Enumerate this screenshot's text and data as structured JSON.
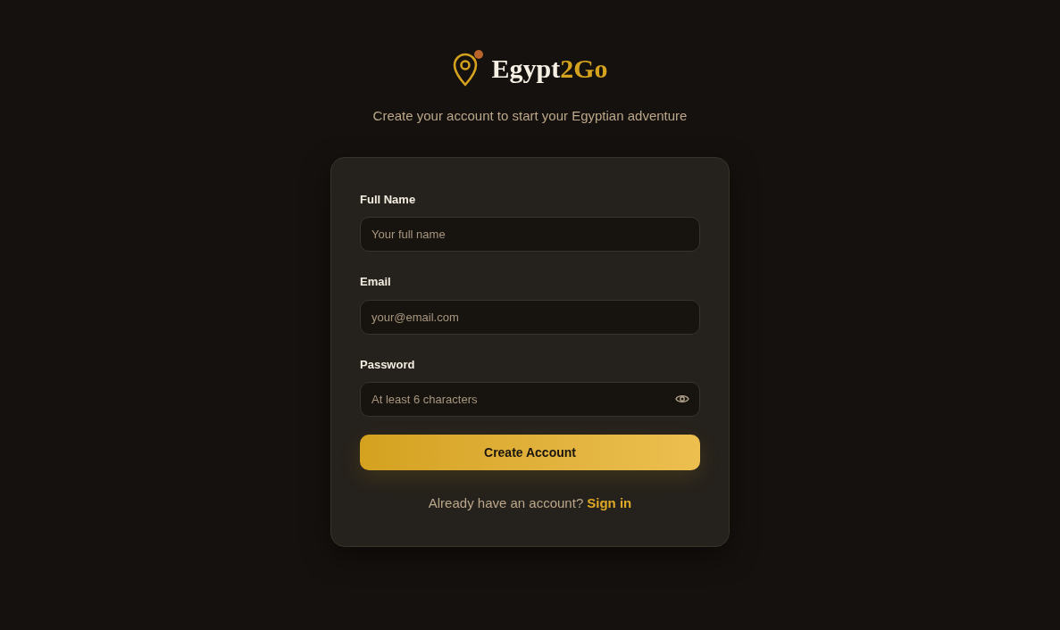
{
  "logo": {
    "parts": [
      {
        "text": "Egypt",
        "kind": "plain"
      },
      {
        "text": "2Go",
        "kind": "accent"
      }
    ]
  },
  "subtitle": "Create your account to start your Egyptian adventure",
  "fields": [
    {
      "label": "Full Name",
      "placeholder": "Your full name",
      "kind": "text"
    },
    {
      "label": "Email",
      "placeholder": "your@email.com",
      "kind": "email"
    },
    {
      "label": "Password",
      "placeholder": "At least 6 characters",
      "kind": "password"
    }
  ],
  "submit": "Create Account",
  "footer": {
    "text": "Already have an account?",
    "link": "Sign in"
  }
}
